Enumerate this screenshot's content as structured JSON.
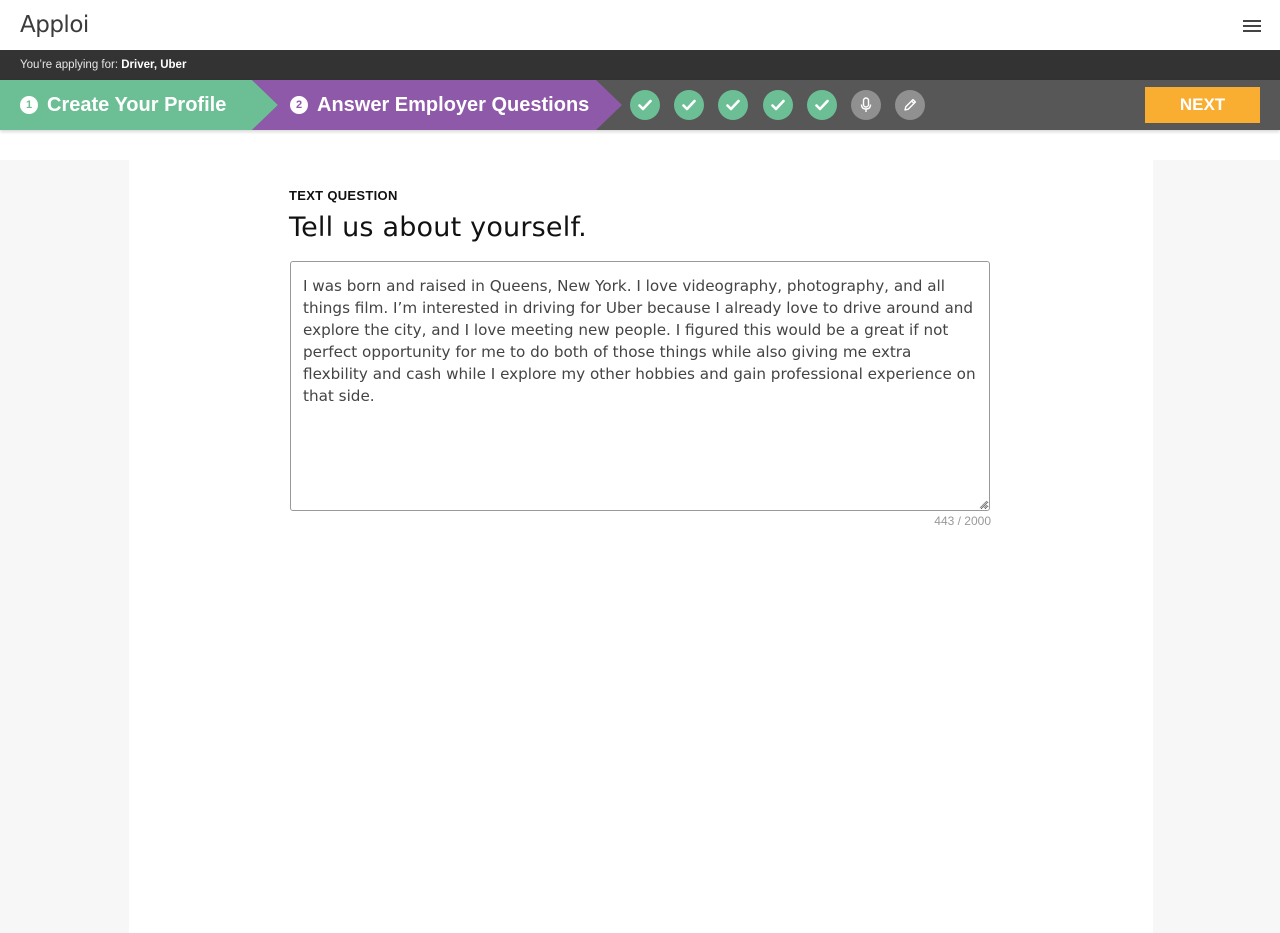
{
  "header": {
    "logo": "Apploi",
    "menu_icon": "hamburger-menu-icon"
  },
  "applying": {
    "prefix": "You’re applying for:",
    "position": "Driver, Uber"
  },
  "steps": {
    "step1": {
      "number": "1",
      "label": "Create Your Profile",
      "color": "#6cbf94"
    },
    "step2": {
      "number": "2",
      "label": "Answer Employer Questions",
      "color": "#8e59a9"
    },
    "question_indicators": [
      {
        "status": "completed",
        "icon": "check-icon"
      },
      {
        "status": "completed",
        "icon": "check-icon"
      },
      {
        "status": "completed",
        "icon": "check-icon"
      },
      {
        "status": "completed",
        "icon": "check-icon"
      },
      {
        "status": "completed",
        "icon": "check-icon"
      },
      {
        "status": "pending",
        "icon": "microphone-icon"
      },
      {
        "status": "current",
        "icon": "pencil-icon"
      }
    ],
    "next_label": "NEXT",
    "next_color": "#f9ae32"
  },
  "question": {
    "type": "TEXT QUESTION",
    "title": "Tell us about yourself.",
    "answer": "I was born and raised in Queens, New York. I love videography, photography, and all things film. I’m interested in driving for Uber because I already love to drive around and explore the city, and I love meeting new people. I figured this would be a great if not perfect opportunity for me to do both of those things while also giving me extra flexbility and cash while I explore my other hobbies and gain professional experience on that side.",
    "char_count": "443 / 2000"
  }
}
